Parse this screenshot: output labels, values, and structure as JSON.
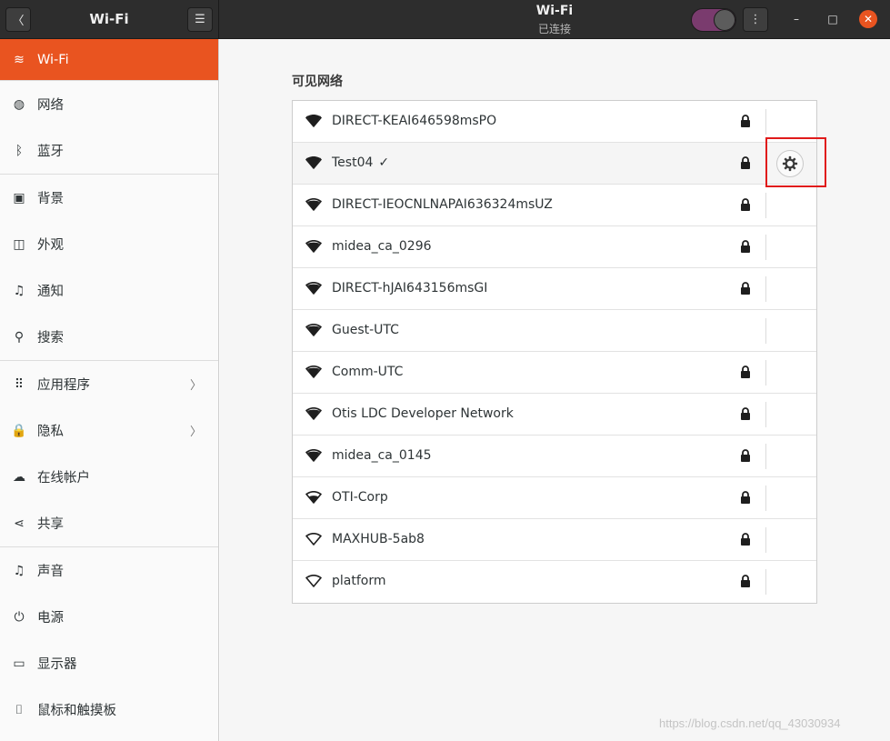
{
  "window": {
    "sidebar_title": "Wi-Fi",
    "title": "Wi-Fi",
    "subtitle": "已连接",
    "wifi_enabled": true,
    "accent_color": "#e95420",
    "highlight_color": "#e01b1b"
  },
  "sidebar": {
    "items": [
      {
        "label": "Wi-Fi",
        "icon": "wifi-icon",
        "glyph": "≋",
        "active": true
      },
      {
        "label": "网络",
        "icon": "network-globe-icon",
        "glyph": "◍"
      },
      {
        "label": "蓝牙",
        "icon": "bluetooth-icon",
        "glyph": "ᛒ"
      },
      {
        "label": "背景",
        "icon": "background-monitor-icon",
        "glyph": "▣"
      },
      {
        "label": "外观",
        "icon": "appearance-icon",
        "glyph": "◫"
      },
      {
        "label": "通知",
        "icon": "bell-icon",
        "glyph": "♫"
      },
      {
        "label": "搜索",
        "icon": "search-icon",
        "glyph": "⚲"
      },
      {
        "label": "应用程序",
        "icon": "apps-grid-icon",
        "glyph": "⠿",
        "chevron": "〉"
      },
      {
        "label": "隐私",
        "icon": "lock-icon",
        "glyph": "🔒",
        "chevron": "〉"
      },
      {
        "label": "在线帐户",
        "icon": "cloud-icon",
        "glyph": "☁"
      },
      {
        "label": "共享",
        "icon": "share-icon",
        "glyph": "⋖"
      },
      {
        "label": "声音",
        "icon": "music-note-icon",
        "glyph": "♫"
      },
      {
        "label": "电源",
        "icon": "power-icon",
        "glyph": "⏻"
      },
      {
        "label": "显示器",
        "icon": "display-icon",
        "glyph": "▭"
      },
      {
        "label": "鼠标和触摸板",
        "icon": "mouse-icon",
        "glyph": "⌷"
      }
    ]
  },
  "main": {
    "section_title": "可见网络",
    "networks": [
      {
        "name": "DIRECT-KEAI646598msPO",
        "signal": 4,
        "secured": true
      },
      {
        "name": "Test04",
        "signal": 4,
        "secured": true,
        "connected": true
      },
      {
        "name": "DIRECT-IEOCNLNAPAI636324msUZ",
        "signal": 3,
        "secured": true
      },
      {
        "name": "midea_ca_0296",
        "signal": 3,
        "secured": true
      },
      {
        "name": "DIRECT-hJAI643156msGI",
        "signal": 3,
        "secured": true
      },
      {
        "name": "Guest-UTC",
        "signal": 3,
        "secured": false
      },
      {
        "name": "Comm-UTC",
        "signal": 3,
        "secured": true
      },
      {
        "name": "Otis LDC Developer Network",
        "signal": 3,
        "secured": true
      },
      {
        "name": "midea_ca_0145",
        "signal": 3,
        "secured": true
      },
      {
        "name": "OTI-Corp",
        "signal": 2,
        "secured": true
      },
      {
        "name": "MAXHUB-5ab8",
        "signal": 1,
        "secured": true
      },
      {
        "name": "platform",
        "signal": 1,
        "secured": true
      }
    ]
  },
  "watermark": "https://blog.csdn.net/qq_43030934"
}
